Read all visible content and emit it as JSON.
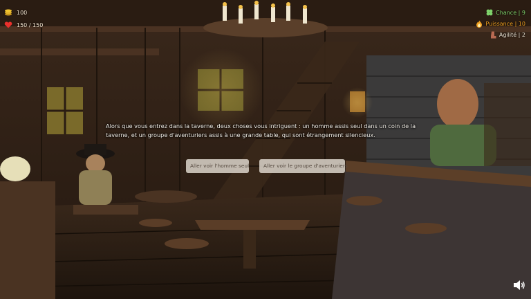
{
  "hud": {
    "gold": "100",
    "health": "150 / 150"
  },
  "stats": [
    {
      "label": "Chance | 9",
      "icon": "clover-icon",
      "color": "#7fd36b"
    },
    {
      "label": "Puissance | 10",
      "icon": "flame-icon",
      "color": "#f0a020"
    },
    {
      "label": "Agilité | 2",
      "icon": "boot-icon",
      "color": "#e8e0d0"
    }
  ],
  "story": {
    "text": "Alors que vous entrez dans la taverne, deux choses vous intriguent : un homme assis seul dans un coin de la taverne, et un groupe d'aventuriers assis à une grande table, qui sont étrangement silencieux."
  },
  "choices": [
    {
      "label": "Aller voir l'homme seul"
    },
    {
      "label": "Aller voir le groupe d'aventuriers"
    }
  ],
  "colors": {
    "gold": "#f3c530",
    "health": "#e8302c",
    "button_bg": "#d7d0c6",
    "button_text": "#55493f"
  }
}
